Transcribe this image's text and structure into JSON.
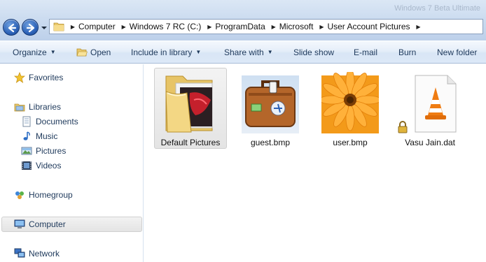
{
  "window": {
    "ghost_title": "Windows 7 Beta Ultimate"
  },
  "address": {
    "crumbs": [
      "Computer",
      "Windows 7 RC (C:)",
      "ProgramData",
      "Microsoft",
      "User Account Pictures"
    ]
  },
  "toolbar": {
    "organize": "Organize",
    "open": "Open",
    "include_in_library": "Include in library",
    "share_with": "Share with",
    "slide_show": "Slide show",
    "email": "E-mail",
    "burn": "Burn",
    "new_folder": "New folder"
  },
  "nav": {
    "favorites": "Favorites",
    "libraries": "Libraries",
    "documents": "Documents",
    "music": "Music",
    "pictures": "Pictures",
    "videos": "Videos",
    "homegroup": "Homegroup",
    "computer": "Computer",
    "network": "Network"
  },
  "files": [
    {
      "name": "Default Pictures",
      "type": "folder",
      "selected": true
    },
    {
      "name": "guest.bmp",
      "type": "image-suitcase"
    },
    {
      "name": "user.bmp",
      "type": "image-flower"
    },
    {
      "name": "Vasu Jain.dat",
      "type": "vlc-file-locked"
    }
  ],
  "colors": {
    "accent": "#2d63b8",
    "toolbar_text": "#1e395b",
    "selection": "#e6e6e6"
  }
}
